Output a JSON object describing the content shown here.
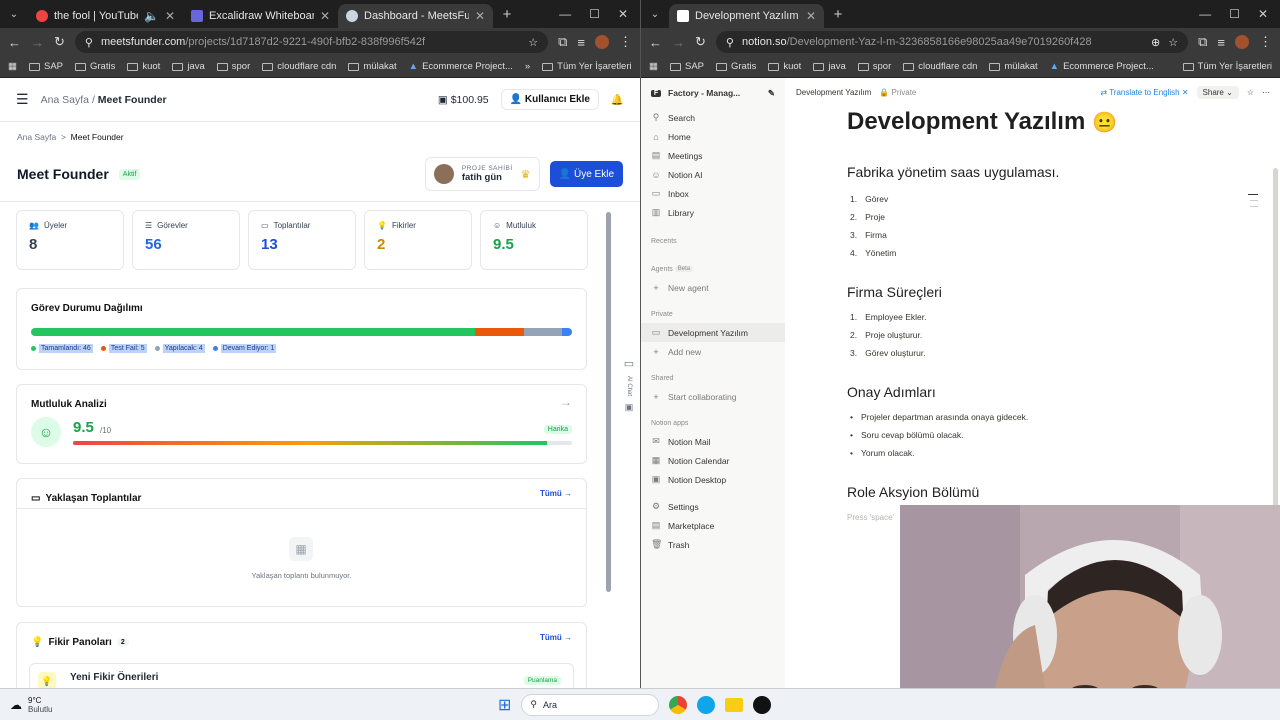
{
  "left_window": {
    "tabs": [
      {
        "title": "the fool | YouTube Music",
        "color": "#ef4444"
      },
      {
        "title": "Excalidraw Whiteboard",
        "color": "#6965db"
      },
      {
        "title": "Dashboard - MeetsFunder",
        "color": "#cbd5e1",
        "active": true
      }
    ],
    "url_host": "meetsfunder.com",
    "url_path": "/projects/1d7187d2-9221-490f-bfb2-838f996f542f",
    "bookmarks": [
      "SAP",
      "Gratis",
      "kuot",
      "java",
      "spor",
      "cloudflare cdn",
      "mülakat",
      "Ecommerce Project..."
    ],
    "bookmarks_more": "»",
    "bookmarks_all": "Tüm Yer İşaretleri"
  },
  "app": {
    "breadcrumb_home": "Ana Sayfa",
    "breadcrumb_sep": "/",
    "breadcrumb_current": "Meet Founder",
    "balance": "$100.95",
    "add_user": "Kullanıcı Ekle",
    "sub_crumb_home": "Ana Sayfa",
    "sub_crumb_sep": ">",
    "sub_crumb_current": "Meet Founder",
    "project_title": "Meet Founder",
    "status": "Aktif",
    "owner_label": "PROJE SAHİBİ",
    "owner_name": "fatih gün",
    "add_member": "Üye Ekle",
    "stats": [
      {
        "label": "Üyeler",
        "value": "8",
        "color": "#374151"
      },
      {
        "label": "Görevler",
        "value": "56",
        "color": "#2563eb"
      },
      {
        "label": "Toplantılar",
        "value": "13",
        "color": "#1d4ed8"
      },
      {
        "label": "Fikirler",
        "value": "2",
        "color": "#ca8a04"
      },
      {
        "label": "Mutluluk",
        "value": "9.5",
        "color": "#16a34a"
      }
    ],
    "task_card": {
      "title": "Görev Durumu Dağılımı",
      "segments": [
        {
          "label": "Tamamlandı: 46",
          "value": 46,
          "color": "#22c55e"
        },
        {
          "label": "Test Fail: 5",
          "value": 5,
          "color": "#ea580c"
        },
        {
          "label": "Yapılacak: 4",
          "value": 4,
          "color": "#94a3b8"
        },
        {
          "label": "Devam Ediyor: 1",
          "value": 1,
          "color": "#3b82f6"
        }
      ]
    },
    "happiness": {
      "title": "Mutluluk Analizi",
      "score": "9.5",
      "out_of": "/10",
      "fill": 0.95,
      "badge": "Harika"
    },
    "meetings": {
      "title": "Yaklaşan Toplantılar",
      "link": "Tümü",
      "empty": "Yaklaşan toplantı bulunmuyor."
    },
    "ideas": {
      "title": "Fikir Panoları",
      "count": "2",
      "link": "Tümü",
      "first_item": "Yeni Fikir Önerileri",
      "first_badge": "Puanlama"
    },
    "ai_chat": "AI Chat"
  },
  "right_window": {
    "tab": "Development Yazılım | Notion",
    "url_host": "notion.so",
    "url_path": "/Development-Yaz-l-m-3236858166e98025aa49e7019260f428",
    "bookmarks": [
      "SAP",
      "Gratis",
      "kuot",
      "java",
      "spor",
      "cloudflare cdn",
      "mülakat",
      "Ecommerce Project..."
    ],
    "bookmarks_all": "Tüm Yer İşaretleri"
  },
  "notion": {
    "workspace": "Factory - Manag...",
    "menu": [
      "Search",
      "Home",
      "Meetings",
      "Notion AI",
      "Inbox",
      "Library"
    ],
    "recents": "Recents",
    "agents": "Agents",
    "agents_badge": "Beta",
    "new_agent": "New agent",
    "private": "Private",
    "private_page": "Development Yazılım",
    "new_page": "Add new",
    "shared": "Shared",
    "start_collab": "Start collaborating",
    "apps_label": "Notion apps",
    "apps": [
      "Notion Mail",
      "Notion Calendar",
      "Notion Desktop"
    ],
    "bottom": [
      "Settings",
      "Marketplace",
      "Trash"
    ],
    "page_crumb": "Development Yazılım",
    "privacy": "Private",
    "translate": "Translate to English",
    "share": "Share",
    "heading": "Development Yazılım",
    "h_saas": "Fabrika yönetim saas uygulaması.",
    "saas_items": [
      "Görev",
      "Proje",
      "Firma",
      "Yönetim"
    ],
    "h_process": "Firma Süreçleri",
    "process_items": [
      "Employee Ekler.",
      "Proje oluşturur.",
      "Görev oluşturur."
    ],
    "h_approval": "Onay Adımları",
    "approval_items": [
      "Projeler departman arasında onaya gidecek.",
      "Soru cevap bölümü olacak.",
      "Yorum olacak."
    ],
    "h_role": "Role Aksyion Bölümü",
    "placeholder": "Press 'space'"
  },
  "taskbar": {
    "temp": "9°C",
    "weather": "Bulutlu",
    "search": "Ara"
  }
}
